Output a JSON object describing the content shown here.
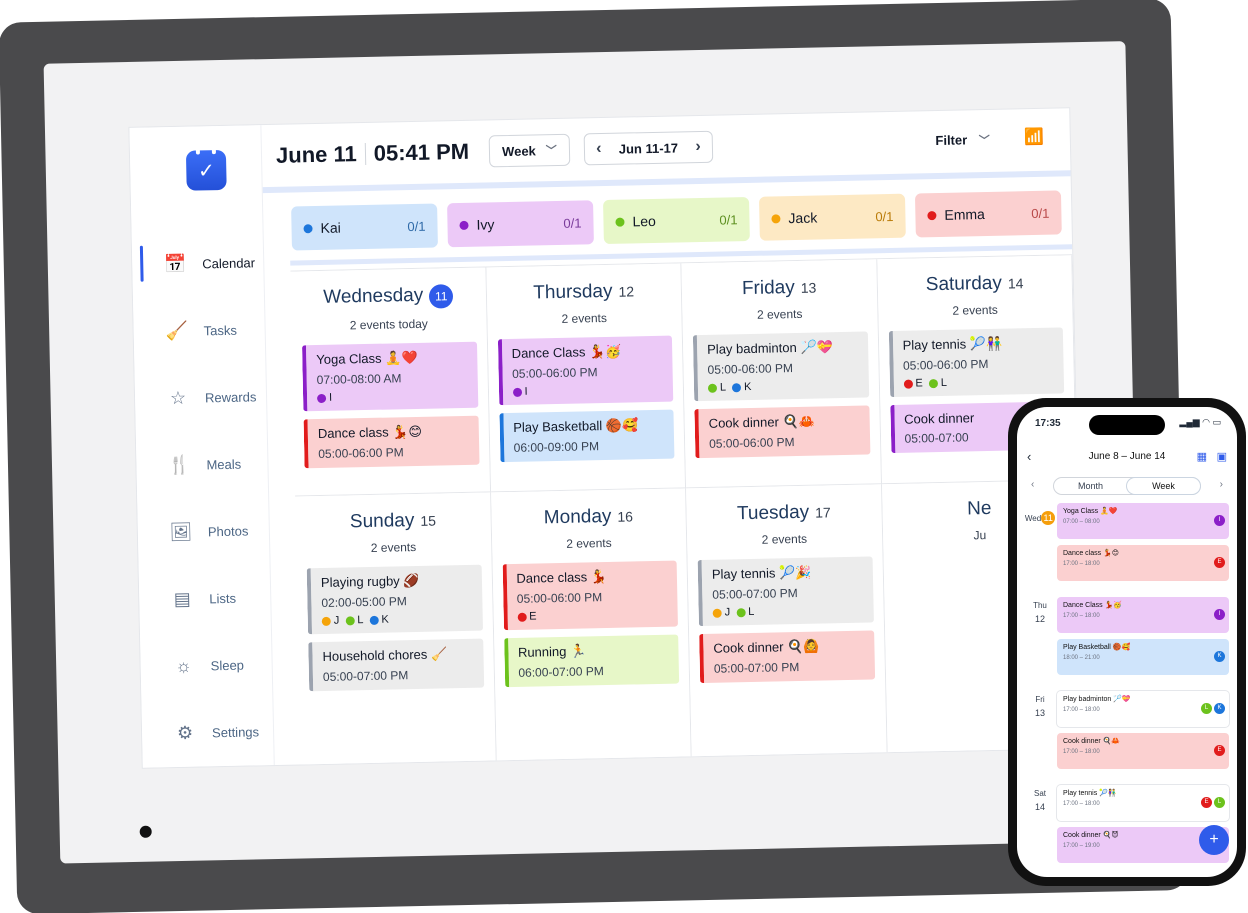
{
  "header": {
    "date": "June 11",
    "time": "05:41 PM",
    "view": "Week",
    "range": "Jun 11-17",
    "filter": "Filter"
  },
  "nav": [
    {
      "label": "Calendar",
      "icon": "calendar-icon",
      "glyph": "📅"
    },
    {
      "label": "Tasks",
      "icon": "broom-icon",
      "glyph": "🧹"
    },
    {
      "label": "Rewards",
      "icon": "star-icon",
      "glyph": "☆"
    },
    {
      "label": "Meals",
      "icon": "utensils-icon",
      "glyph": "🍴"
    },
    {
      "label": "Photos",
      "icon": "photo-icon",
      "glyph": "🖼"
    },
    {
      "label": "Lists",
      "icon": "list-icon",
      "glyph": "▤"
    },
    {
      "label": "Sleep",
      "icon": "sun-icon",
      "glyph": "☼"
    },
    {
      "label": "Settings",
      "icon": "gear-icon",
      "glyph": "⚙"
    }
  ],
  "members": [
    {
      "name": "Kai",
      "count": "0/1",
      "bg": "#cfe4fb",
      "dot": "#1d76db",
      "fg": "#2f6aa8"
    },
    {
      "name": "Ivy",
      "count": "0/1",
      "bg": "#ecc9f7",
      "dot": "#8b1fc8",
      "fg": "#7a3b9b"
    },
    {
      "name": "Leo",
      "count": "0/1",
      "bg": "#e7f7c8",
      "dot": "#6cc21c",
      "fg": "#5c8f1f"
    },
    {
      "name": "Jack",
      "count": "0/1",
      "bg": "#fde9c4",
      "dot": "#f5a40a",
      "fg": "#b97a06"
    },
    {
      "name": "Emma",
      "count": "0/1",
      "bg": "#fbd0d0",
      "dot": "#e11c1c",
      "fg": "#b84848"
    }
  ],
  "days": [
    {
      "name": "Wednesday",
      "num": "11",
      "sub": "2 events today",
      "today": true,
      "events": [
        {
          "title": "Yoga Class 🧘❤️",
          "time": "07:00-08:00 AM",
          "bg": "#ecc9f7",
          "bar": "#8b1fc8",
          "ppl": [
            {
              "c": "#8b1fc8",
              "l": "I"
            }
          ]
        },
        {
          "title": "Dance class 💃😊",
          "time": "05:00-06:00 PM",
          "bg": "#fbd0d0",
          "bar": "#e11c1c",
          "ppl": []
        }
      ]
    },
    {
      "name": "Thursday",
      "num": "12",
      "sub": "2 events",
      "events": [
        {
          "title": "Dance Class 💃🥳",
          "time": "05:00-06:00 PM",
          "bg": "#ecc9f7",
          "bar": "#8b1fc8",
          "ppl": [
            {
              "c": "#8b1fc8",
              "l": "I"
            }
          ]
        },
        {
          "title": "Play Basketball 🏀🥰",
          "time": "06:00-09:00 PM",
          "bg": "#cfe4fb",
          "bar": "#1d76db",
          "ppl": []
        }
      ]
    },
    {
      "name": "Friday",
      "num": "13",
      "sub": "2 events",
      "events": [
        {
          "title": "Play badminton 🏸💝",
          "time": "05:00-06:00 PM",
          "bg": "#ececec",
          "bar": "#9ca3af",
          "ppl": [
            {
              "c": "#6cc21c",
              "l": "L"
            },
            {
              "c": "#1d76db",
              "l": "K"
            }
          ]
        },
        {
          "title": "Cook dinner 🍳🦀",
          "time": "05:00-06:00 PM",
          "bg": "#fbd0d0",
          "bar": "#e11c1c",
          "ppl": []
        }
      ]
    },
    {
      "name": "Saturday",
      "num": "14",
      "sub": "2 events",
      "events": [
        {
          "title": "Play tennis 🎾👫",
          "time": "05:00-06:00 PM",
          "bg": "#ececec",
          "bar": "#9ca3af",
          "ppl": [
            {
              "c": "#e11c1c",
              "l": "E"
            },
            {
              "c": "#6cc21c",
              "l": "L"
            }
          ]
        },
        {
          "title": "Cook dinner",
          "time": "05:00-07:00",
          "bg": "#ecc9f7",
          "bar": "#8b1fc8",
          "ppl": []
        }
      ]
    },
    {
      "name": "Sunday",
      "num": "15",
      "sub": "2 events",
      "events": [
        {
          "title": "Playing rugby 🏈",
          "time": "02:00-05:00 PM",
          "bg": "#ececec",
          "bar": "#9ca3af",
          "ppl": [
            {
              "c": "#f5a40a",
              "l": "J"
            },
            {
              "c": "#6cc21c",
              "l": "L"
            },
            {
              "c": "#1d76db",
              "l": "K"
            }
          ]
        },
        {
          "title": "Household chores 🧹",
          "time": "05:00-07:00 PM",
          "bg": "#ececec",
          "bar": "#9ca3af",
          "ppl": []
        }
      ]
    },
    {
      "name": "Monday",
      "num": "16",
      "sub": "2 events",
      "events": [
        {
          "title": "Dance class 💃",
          "time": "05:00-06:00 PM",
          "bg": "#fbd0d0",
          "bar": "#e11c1c",
          "ppl": [
            {
              "c": "#e11c1c",
              "l": "E"
            }
          ]
        },
        {
          "title": "Running 🏃",
          "time": "06:00-07:00 PM",
          "bg": "#e7f7c8",
          "bar": "#6cc21c",
          "ppl": []
        }
      ]
    },
    {
      "name": "Tuesday",
      "num": "17",
      "sub": "2 events",
      "events": [
        {
          "title": "Play tennis 🎾🎉",
          "time": "05:00-07:00 PM",
          "bg": "#ececec",
          "bar": "#9ca3af",
          "ppl": [
            {
              "c": "#f5a40a",
              "l": "J"
            },
            {
              "c": "#6cc21c",
              "l": "L"
            }
          ]
        },
        {
          "title": "Cook dinner 🍳🙆",
          "time": "05:00-07:00 PM",
          "bg": "#fbd0d0",
          "bar": "#e11c1c",
          "ppl": []
        }
      ]
    },
    {
      "name": "Ne",
      "num": "",
      "sub": "Ju",
      "events": []
    }
  ],
  "phone": {
    "status_time": "17:35",
    "signal": "▂▄▆ ◠ ▭",
    "title": "June 8 – June 14",
    "seg": [
      "Month",
      "Week"
    ],
    "fab": "+",
    "days": [
      {
        "dow": "Wed",
        "num": "11",
        "today": true,
        "events": [
          {
            "title": "Yoga Class 🧘❤️",
            "time": "07:00 – 08:00",
            "bg": "#ecc9f7",
            "av": [
              {
                "c": "#8b1fc8",
                "l": "I"
              }
            ]
          },
          {
            "title": "Dance class 💃😊",
            "time": "17:00 – 18:00",
            "bg": "#fbd0d0",
            "av": [
              {
                "c": "#e11c1c",
                "l": "E"
              }
            ]
          }
        ]
      },
      {
        "dow": "Thu",
        "num": "12",
        "events": [
          {
            "title": "Dance Class 💃🥳",
            "time": "17:00 – 18:00",
            "bg": "#ecc9f7",
            "av": [
              {
                "c": "#8b1fc8",
                "l": "I"
              }
            ]
          },
          {
            "title": "Play Basketball 🏀🥰",
            "time": "18:00 – 21:00",
            "bg": "#cfe4fb",
            "av": [
              {
                "c": "#1d76db",
                "l": "K"
              }
            ]
          }
        ]
      },
      {
        "dow": "Fri",
        "num": "13",
        "events": [
          {
            "title": "Play badminton 🏸💝",
            "time": "17:00 – 18:00",
            "bg": "#ffffff",
            "av": [
              {
                "c": "#6cc21c",
                "l": "L"
              },
              {
                "c": "#1d76db",
                "l": "K"
              }
            ]
          },
          {
            "title": "Cook dinner 🍳🦀",
            "time": "17:00 – 18:00",
            "bg": "#fbd0d0",
            "av": [
              {
                "c": "#e11c1c",
                "l": "E"
              }
            ]
          }
        ]
      },
      {
        "dow": "Sat",
        "num": "14",
        "events": [
          {
            "title": "Play tennis 🎾👫",
            "time": "17:00 – 18:00",
            "bg": "#ffffff",
            "av": [
              {
                "c": "#e11c1c",
                "l": "E"
              },
              {
                "c": "#6cc21c",
                "l": "L"
              }
            ]
          },
          {
            "title": "Cook dinner 🍳😈",
            "time": "17:00 – 19:00",
            "bg": "#ecc9f7",
            "av": [
              {
                "c": "#8b1fc8",
                "l": "I"
              }
            ]
          }
        ]
      }
    ]
  }
}
